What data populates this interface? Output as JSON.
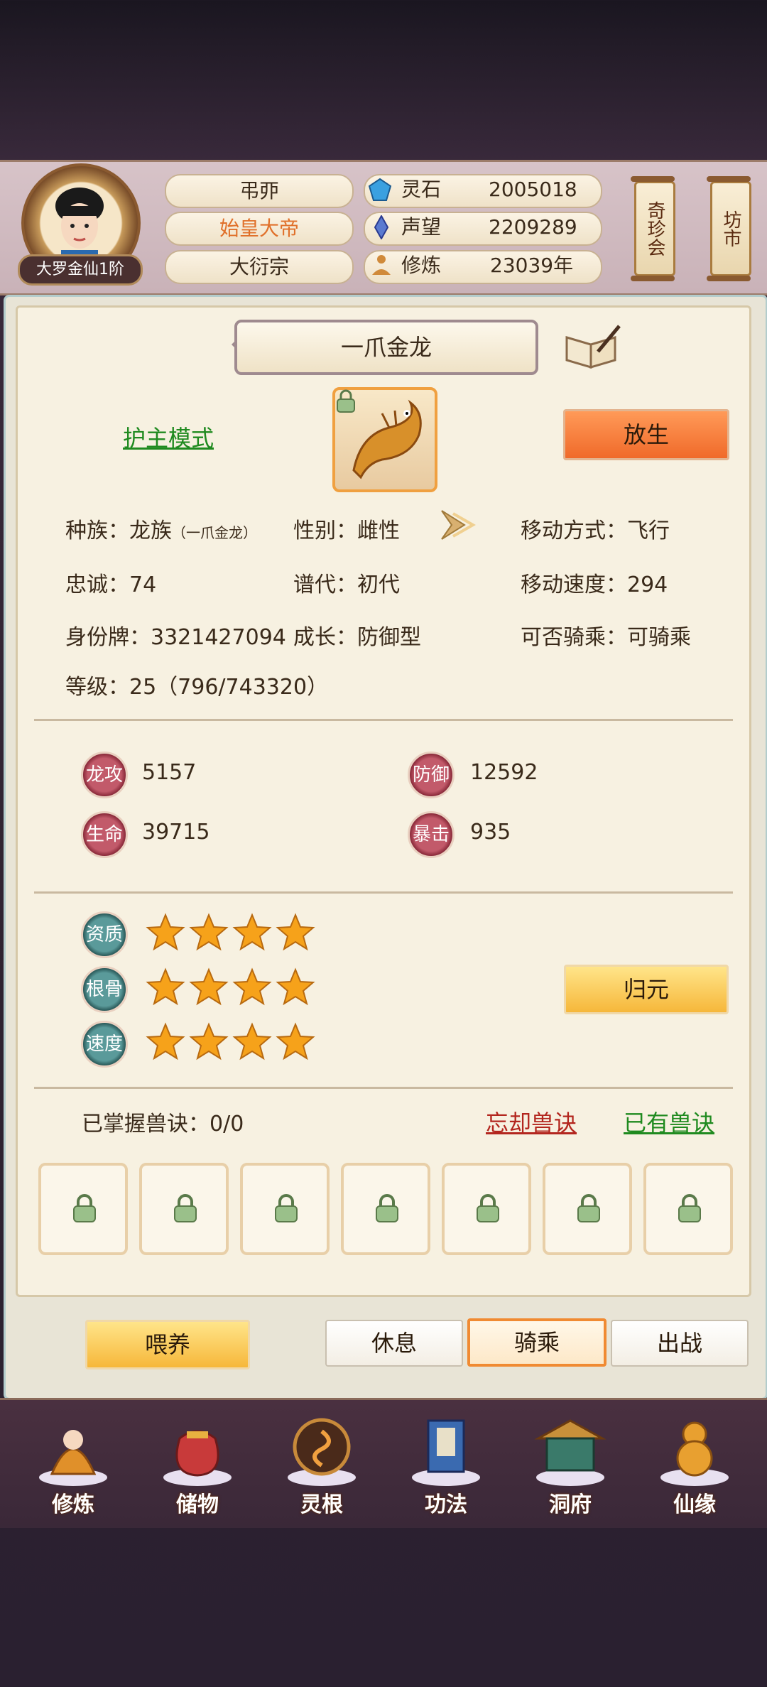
{
  "player": {
    "rank": "大罗金仙1阶",
    "name": "弔丣",
    "title": "始皇大帝",
    "sect": "大衍宗"
  },
  "resources": [
    {
      "label": "灵石",
      "value": "2005018",
      "icon": "spirit-stone-icon",
      "color": "#3aa0e0"
    },
    {
      "label": "声望",
      "value": "2209289",
      "icon": "reputation-crystal-icon",
      "color": "#5a7ad0"
    },
    {
      "label": "修炼",
      "value": "23039年",
      "icon": "meditation-icon",
      "color": "#d08a3a"
    }
  ],
  "side_tags": {
    "treasure": "奇珍会",
    "market": "坊市"
  },
  "pet": {
    "name": "一爪金龙",
    "mode_link": "护主模式",
    "release_btn": "放生",
    "race_label": "种族：",
    "race": "龙族",
    "race_sub": "（一爪金龙）",
    "gender_label": "性别：",
    "gender": "雌性",
    "move_label": "移动方式：",
    "move": "飞行",
    "loyalty_label": "忠诚：",
    "loyalty": "74",
    "generation_label": "谱代：",
    "generation": "初代",
    "speed_label": "移动速度：",
    "speed": "294",
    "id_label": "身份牌：",
    "id": "3321427094",
    "growth_label": "成长：",
    "growth": "防御型",
    "ride_label": "可否骑乘：",
    "ride": "可骑乘",
    "level_label": "等级：",
    "level": "25（796/743320）"
  },
  "stats": [
    {
      "label": "龙攻",
      "value": "5157"
    },
    {
      "label": "防御",
      "value": "12592"
    },
    {
      "label": "生命",
      "value": "39715"
    },
    {
      "label": "暴击",
      "value": "935"
    }
  ],
  "talents": [
    {
      "label": "资质",
      "stars": 4
    },
    {
      "label": "根骨",
      "stars": 4
    },
    {
      "label": "速度",
      "stars": 4
    }
  ],
  "restore_btn": "归元",
  "skills": {
    "mastered": "已掌握兽诀：0/0",
    "forget_link": "忘却兽诀",
    "owned_link": "已有兽诀",
    "slots": 7
  },
  "actions": {
    "feed": "喂养",
    "rest": "休息",
    "ride": "骑乘",
    "battle": "出战"
  },
  "nav": [
    "修炼",
    "储物",
    "灵根",
    "功法",
    "洞府",
    "仙缘"
  ],
  "colors": {
    "accent_orange": "#f06a2a",
    "gold": "#f6b73a",
    "link_green": "#1f8a1f",
    "link_red": "#b3261e"
  }
}
